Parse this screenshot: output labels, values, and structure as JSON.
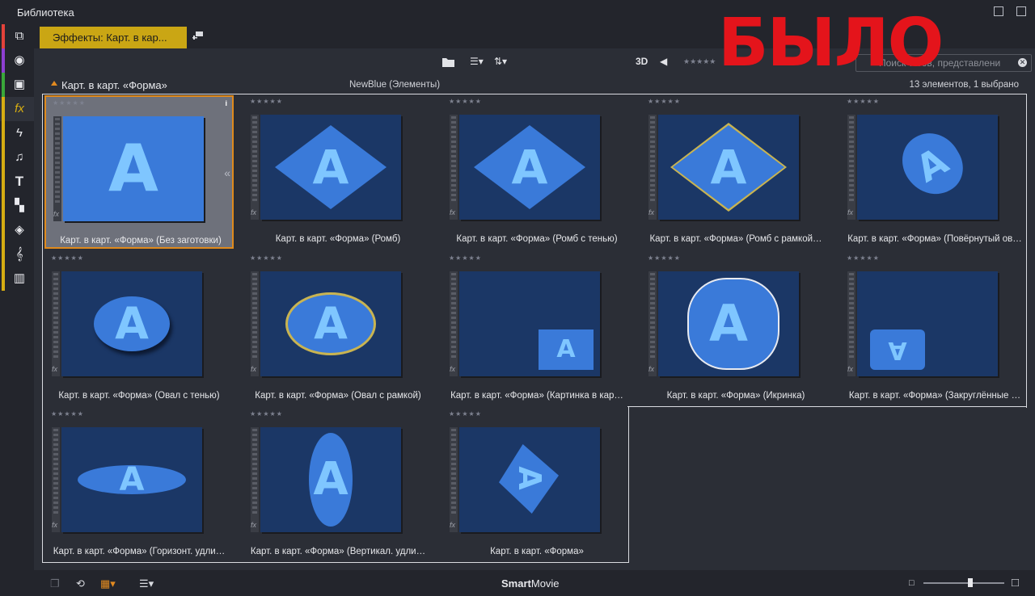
{
  "window": {
    "title": "Библиотека"
  },
  "tab": {
    "label": "Эффекты: Карт. в кар..."
  },
  "toolbar": {
    "mode_3d": "3D",
    "search_placeholder": "Поиск тегов, представлени"
  },
  "section": {
    "name": "Карт. в карт. «Форма»",
    "provider": "NewBlue (Элементы)",
    "count": "13 элементов, 1 выбрано"
  },
  "rail_colors": [
    "#e3423a",
    "#8d3fd1",
    "#3aa83a",
    "#d6ad12"
  ],
  "items": [
    {
      "caption": "Карт. в карт. «Форма» (Без заготовки)",
      "selected": true,
      "info": "i",
      "chev": "«"
    },
    {
      "caption": "Карт. в карт. «Форма» (Ромб)"
    },
    {
      "caption": "Карт. в карт. «Форма» (Ромб с тенью)"
    },
    {
      "caption": "Карт. в карт. «Форма» (Ромб с рамкой…"
    },
    {
      "caption": "Карт. в карт. «Форма» (Повёрнутый ов…"
    },
    {
      "caption": "Карт. в карт. «Форма» (Овал с тенью)"
    },
    {
      "caption": "Карт. в карт. «Форма» (Овал с рамкой)"
    },
    {
      "caption": "Карт. в карт. «Форма» (Картинка в кар…"
    },
    {
      "caption": "Карт. в карт. «Форма» (Икринка)"
    },
    {
      "caption": "Карт. в карт. «Форма» (Закруглённые …"
    },
    {
      "caption": "Карт. в карт. «Форма» (Горизонт. удли…"
    },
    {
      "caption": "Карт. в карт. «Форма» (Вертикал. удли…"
    },
    {
      "caption": "Карт. в карт. «Форма»"
    }
  ],
  "thumb_letter": "A",
  "stars": "★★★★★",
  "fx_mark": "fx",
  "stamp": "БЫЛО",
  "bottom": {
    "brand_bold": "Smart",
    "brand_rest": "Movie"
  }
}
